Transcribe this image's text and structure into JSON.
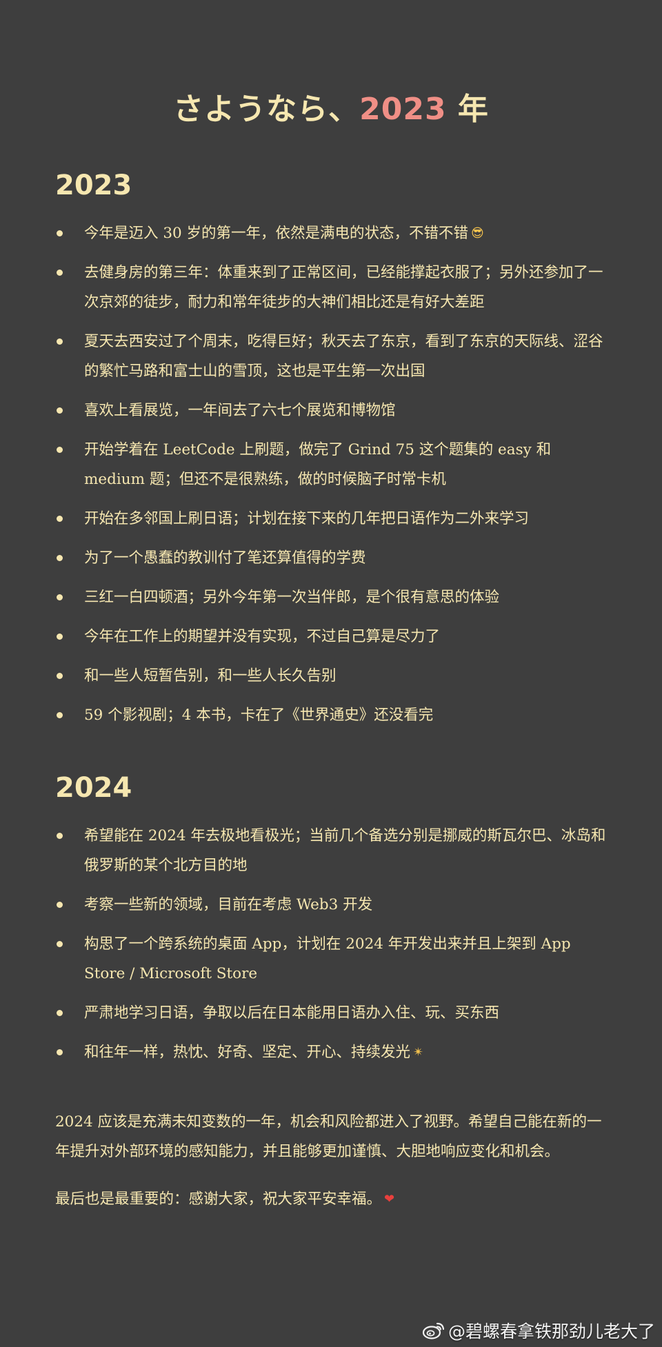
{
  "title": {
    "prefix": "さようなら、",
    "year": "2023",
    "suffix": " 年"
  },
  "section_2023": {
    "heading": "2023",
    "items": [
      "今年是迈入 30 岁的第一年，依然是满电的状态，不错不错",
      "去健身房的第三年：体重来到了正常区间，已经能撑起衣服了；另外还参加了一次京郊的徒步，耐力和常年徒步的大神们相比还是有好大差距",
      "夏天去西安过了个周末，吃得巨好；秋天去了东京，看到了东京的天际线、涩谷的繁忙马路和富士山的雪顶，这也是平生第一次出国",
      "喜欢上看展览，一年间去了六七个展览和博物馆",
      "开始学着在 LeetCode 上刷题，做完了 Grind 75 这个题集的 easy 和 medium 题；但还不是很熟练，做的时候脑子时常卡机",
      "开始在多邻国上刷日语；计划在接下来的几年把日语作为二外来学习",
      "为了一个愚蠢的教训付了笔还算值得的学费",
      "三红一白四顿酒；另外今年第一次当伴郎，是个很有意思的体验",
      "今年在工作上的期望并没有实现，不过自己算是尽力了",
      "和一些人短暂告别，和一些人长久告别",
      "59 个影视剧；4 本书，卡在了《世界通史》还没看完"
    ]
  },
  "section_2024": {
    "heading": "2024",
    "items": [
      "希望能在 2024 年去极地看极光；当前几个备选分别是挪威的斯瓦尔巴、冰岛和俄罗斯的某个北方目的地",
      "考察一些新的领域，目前在考虑 Web3 开发",
      "构思了一个跨系统的桌面 App，计划在 2024 年开发出来并且上架到 App Store / Microsoft Store",
      "严肃地学习日语，争取以后在日本能用日语办入住、玩、买东西",
      "和往年一样，热忱、好奇、坚定、开心、持续发光"
    ]
  },
  "closing": {
    "paragraph_1": "2024 应该是充满未知变数的一年，机会和风险都进入了视野。希望自己能在新的一年提升对外部环境的感知能力，并且能够更加谨慎、大胆地响应变化和机会。",
    "paragraph_2": "最后也是最重要的：感谢大家，祝大家平安幸福。"
  },
  "emoji": {
    "sunglasses": "😎",
    "sparkle": "✴",
    "heart": "❤"
  },
  "watermark": {
    "icon": "weibo-icon",
    "text": "@碧螺春拿铁那劲儿老大了"
  },
  "colors": {
    "background": "#3e3e3e",
    "text": "#f6e7b0",
    "accent_year": "#f08f86"
  }
}
